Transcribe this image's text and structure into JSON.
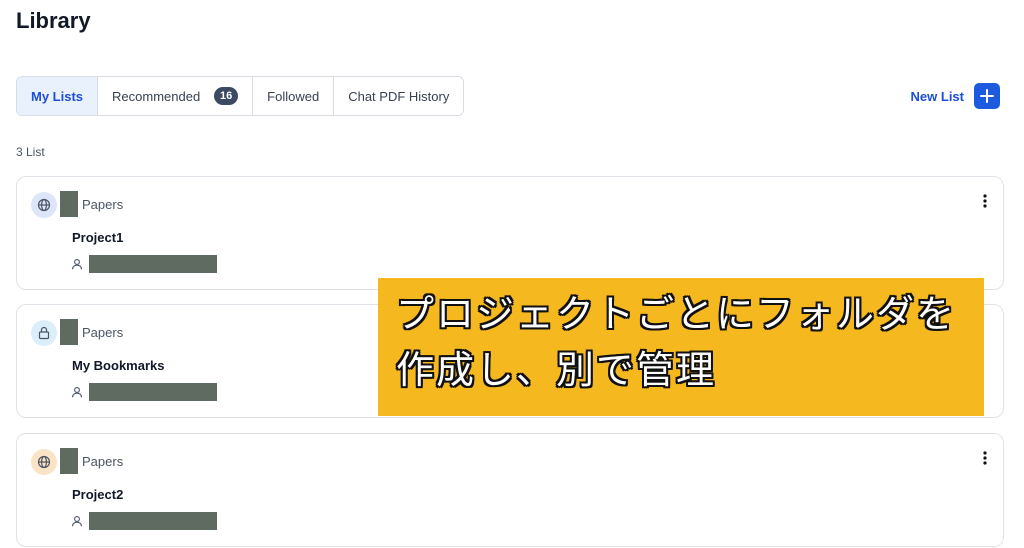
{
  "page": {
    "title": "Library"
  },
  "tabs": [
    {
      "label": "My Lists",
      "active": true
    },
    {
      "label": "Recommended",
      "badge": "16",
      "active": false
    },
    {
      "label": "Followed",
      "active": false
    },
    {
      "label": "Chat PDF History",
      "active": false
    }
  ],
  "new_list": {
    "label": "New List",
    "icon": "plus-icon"
  },
  "list_count": "3 List",
  "cards": [
    {
      "icon": "globe-icon",
      "icon_color": "#dde5fb",
      "type_label": "Papers",
      "name": "Project1"
    },
    {
      "icon": "lock-icon",
      "icon_color": "#dceefa",
      "type_label": "Papers",
      "name": "My Bookmarks"
    },
    {
      "icon": "globe-icon",
      "icon_color": "#fbe4c6",
      "type_label": "Papers",
      "name": "Project2"
    }
  ],
  "overlay": {
    "line1": "プロジェクトごとにフォルダを",
    "line2": "作成し、別で管理"
  },
  "colors": {
    "accent": "#1d5ae0",
    "overlay_bg": "#f5b81e",
    "redaction": "#5f6b61"
  }
}
